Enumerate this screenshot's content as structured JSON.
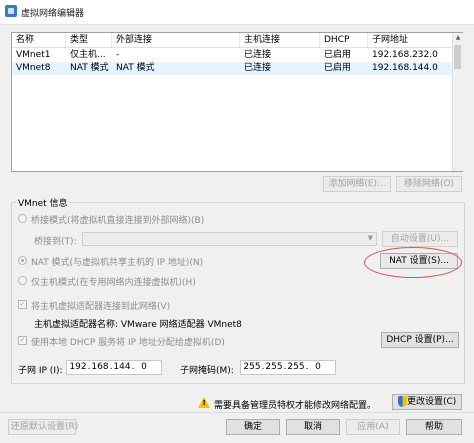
{
  "window": {
    "title": "虚拟网络编辑器"
  },
  "network_list": {
    "columns": [
      "名称",
      "类型",
      "外部连接",
      "主机连接",
      "DHCP",
      "子网地址"
    ],
    "rows": [
      {
        "name": "VMnet1",
        "type": "仅主机...",
        "external": "-",
        "host": "已连接",
        "dhcp": "已启用",
        "subnet": "192.168.232.0",
        "selected": false
      },
      {
        "name": "VMnet8",
        "type": "NAT 模式",
        "external": "NAT 模式",
        "host": "已连接",
        "dhcp": "已启用",
        "subnet": "192.168.144.0",
        "selected": true
      }
    ]
  },
  "list_buttons": {
    "add": "添加网络(E)...",
    "remove": "移除网络(O)"
  },
  "vmnet_info": {
    "legend": "VMnet 信息",
    "bridged_label": "桥接模式(将虚拟机直接连接到外部网络)(B)",
    "bridged_to_label": "桥接到(T):",
    "bridged_to_value": "",
    "auto_settings_button": "自动设置(U)...",
    "nat_label": "NAT 模式(与虚拟机共享主机的 IP 地址)(N)",
    "nat_settings_button": "NAT 设置(S)...",
    "hostonly_label": "仅主机模式(在专用网络内连接虚拟机)(H)",
    "connect_adapter_label": "将主机虚拟适配器连接到此网络(V)",
    "adapter_name_label": "主机虚拟适配器名称: VMware 网络适配器 VMnet8",
    "use_dhcp_label": "使用本地 DHCP 服务将 IP 地址分配给虚拟机(D)",
    "dhcp_settings_button": "DHCP 设置(P)...",
    "subnet_ip_label": "子网 IP (I):",
    "subnet_ip": [
      "192",
      "168",
      "144",
      "0"
    ],
    "subnet_mask_label": "子网掩码(M):",
    "subnet_mask": [
      "255",
      "255",
      "255",
      "0"
    ]
  },
  "admin_notice": "需要具备管理员特权才能修改网络配置。",
  "change_settings_button": "更改设置(C)",
  "footer_buttons": {
    "restore_defaults": "还原默认设置(R)",
    "ok": "确定",
    "cancel": "取消",
    "apply": "应用(A)",
    "help": "帮助"
  },
  "colors": {
    "accent_red_ellipse": "#d9534f",
    "selected_row": "#e5f3ff"
  }
}
